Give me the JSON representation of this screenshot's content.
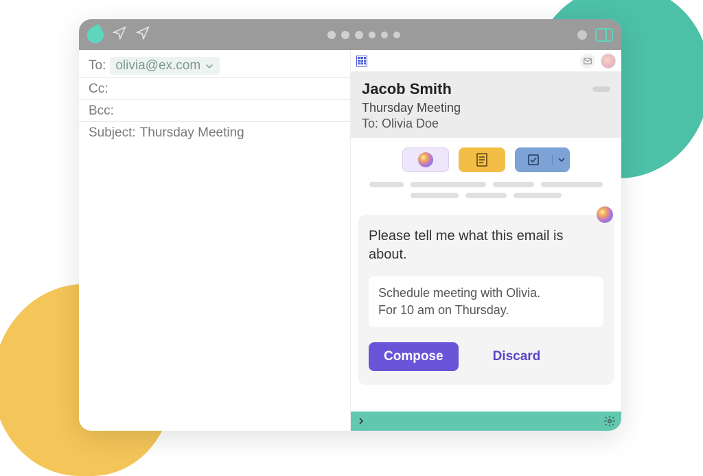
{
  "compose": {
    "to_label": "To:",
    "to_value": "olivia@ex.com",
    "cc_label": "Cc:",
    "bcc_label": "Bcc:",
    "subject_label": "Subject:",
    "subject_value": "Thursday Meeting"
  },
  "panel": {
    "sender": "Jacob Smith",
    "subject": "Thursday Meeting",
    "to_line": "To: Olivia Doe",
    "prompt": "Please tell me what this email is about.",
    "input_line1": "Schedule meeting with Olivia.",
    "input_line2": "For 10 am on Thursday.",
    "compose_btn": "Compose",
    "discard_btn": "Discard"
  }
}
